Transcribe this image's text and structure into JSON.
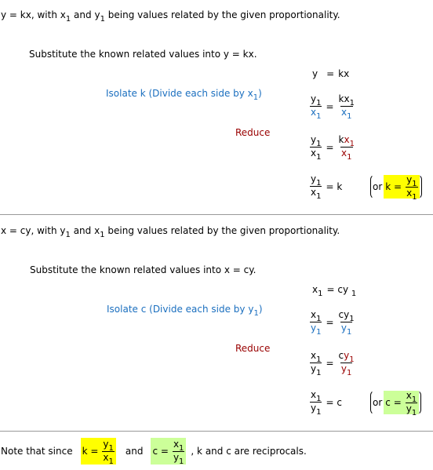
{
  "section1": {
    "intro": {
      "a": "y = kx,  with ",
      "v1": "x",
      "sub1": "1",
      "b": " and ",
      "v2": "y",
      "sub2": "1",
      "c": " being values related by the given proportionality."
    },
    "substitute": "Substitute the known related values into  y = kx.",
    "isolate": {
      "text": "Isolate k (Divide each side by x",
      "sub": "1",
      "close": ")"
    },
    "reduce": "Reduce",
    "line1": {
      "lhs": "y",
      "eq": "=",
      "rhs": "kx"
    },
    "line2": {
      "num_l": "y",
      "den_l": "x",
      "eq": "=",
      "num_r_a": "k",
      "num_r_b": "x",
      "den_r": "x",
      "sub": "1"
    },
    "line3": {
      "num_l": "y",
      "den_l": "x",
      "eq": "=",
      "num_r_a": "k",
      "num_r_b": "x",
      "den_r": "x",
      "sub": "1"
    },
    "line4": {
      "num_l": "y",
      "den_l": "x",
      "eq": "= k",
      "or": "or",
      "k_eq": "k =",
      "num": "y",
      "den": "x",
      "sub": "1"
    }
  },
  "section2": {
    "intro": {
      "a": "x = cy,  with ",
      "v1": "y",
      "sub1": "1",
      "b": " and ",
      "v2": "x",
      "sub2": "1",
      "c": " being values related by the given proportionality."
    },
    "substitute": "Substitute the known related values into  x = cy.",
    "isolate": {
      "text": "Isolate c (Divide each side by y",
      "sub": "1",
      "close": ")"
    },
    "reduce": "Reduce",
    "line1": {
      "lhs": "x",
      "eq": "= cy",
      "sub": "1"
    },
    "line2": {
      "num_l": "x",
      "den_l": "y",
      "eq": "=",
      "num_r_a": "c",
      "num_r_b": "y",
      "den_r": "y",
      "sub": "1"
    },
    "line3": {
      "num_l": "x",
      "den_l": "y",
      "eq": "=",
      "num_r_a": "c",
      "num_r_b": "y",
      "den_r": "y",
      "sub": "1"
    },
    "line4": {
      "num_l": "x",
      "den_l": "y",
      "eq": "= c",
      "or": "or",
      "c_eq": "c =",
      "num": "x",
      "den": "y",
      "sub": "1"
    }
  },
  "note": {
    "prefix": "Note that since",
    "k_eq": "k =",
    "k_num": "y",
    "k_den": "x",
    "and": "and",
    "c_eq": "c =",
    "c_num": "x",
    "c_den": "y",
    "sub": "1",
    "suffix": ", k and c are reciprocals."
  },
  "colors": {
    "blue": "#1b6fbf",
    "red": "#990000",
    "yellow": "#ffff00",
    "green": "#ccff99",
    "divider": "#999999"
  }
}
